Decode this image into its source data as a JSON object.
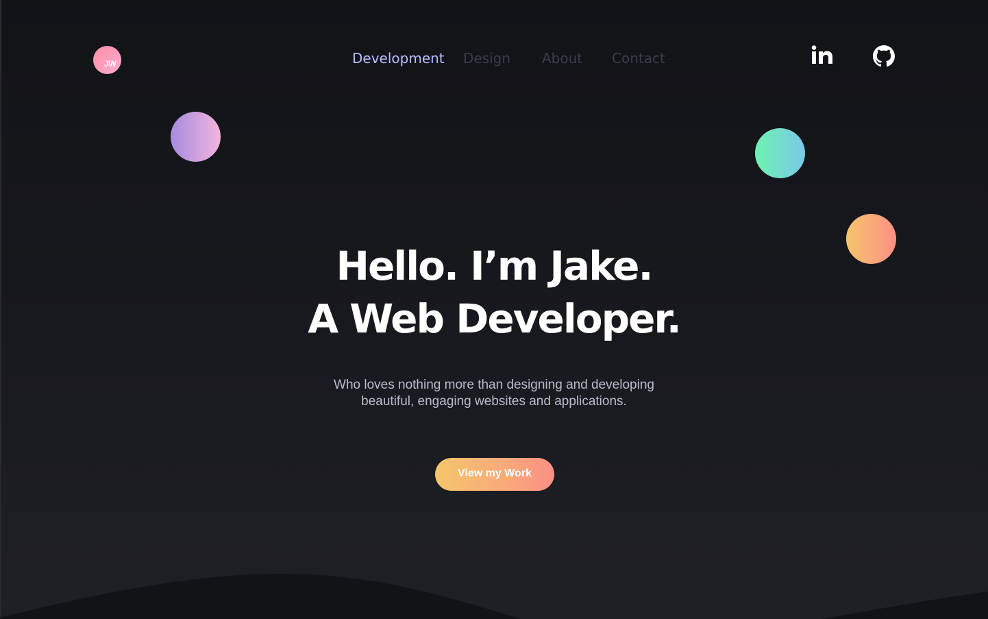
{
  "logo": {
    "initials": "JW"
  },
  "nav": {
    "items": [
      {
        "label": "Development",
        "active": true
      },
      {
        "label": "Design",
        "active": false
      },
      {
        "label": "About",
        "active": false
      },
      {
        "label": "Contact",
        "active": false
      }
    ]
  },
  "social": {
    "icons": [
      "linkedin-icon",
      "github-icon"
    ]
  },
  "hero": {
    "title_line1": "Hello. I’m Jake.",
    "title_line2": "A Web Developer.",
    "subtitle_line1": "Who loves nothing more than designing and developing",
    "subtitle_line2": "beautiful, engaging websites and applications.",
    "cta_label": "View my Work"
  },
  "colors": {
    "background": "#121317",
    "nav_active": "#b4c0ff",
    "nav_inactive": "#3a3d4a",
    "cta_gradient_start": "#f5c56a",
    "cta_gradient_end": "#fd8f85",
    "orb_purple": "#a78bdf",
    "orb_green": "#6ef2b0",
    "orb_orange": "#f9a97a"
  }
}
